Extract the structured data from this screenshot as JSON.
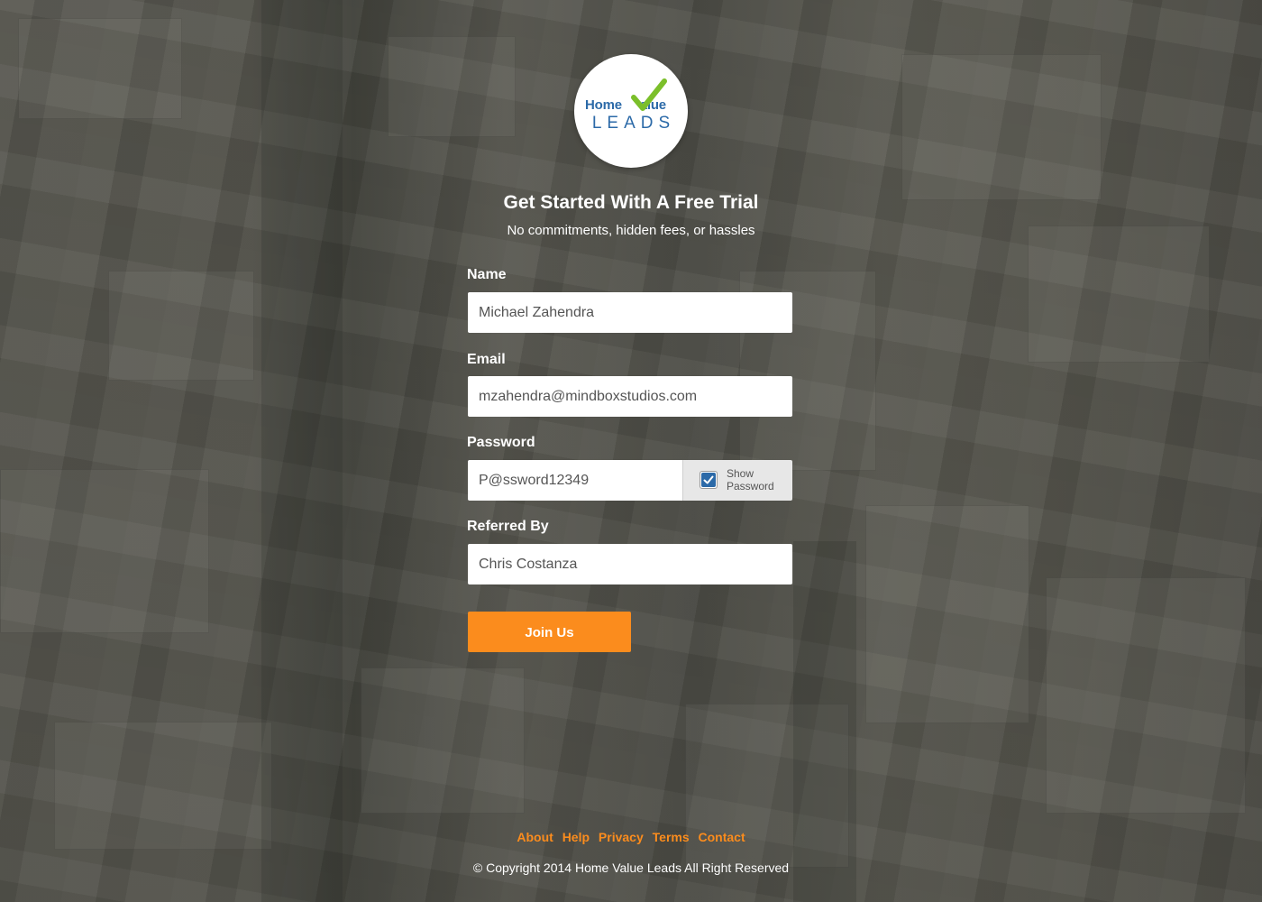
{
  "logo": {
    "brand_word_1": "Home",
    "brand_word_2": "alue",
    "brand_line_2": "LEADS",
    "check_icon": "checkmark-icon",
    "colors": {
      "blue": "#2c6aa8",
      "green": "#7bbf2a"
    }
  },
  "header": {
    "title": "Get Started With A Free Trial",
    "subtitle": "No commitments, hidden fees, or hassles"
  },
  "form": {
    "name_label": "Name",
    "name_value": "Michael Zahendra",
    "email_label": "Email",
    "email_value": "mzahendra@mindboxstudios.com",
    "password_label": "Password",
    "password_value": "P@ssword12349",
    "show_password_label": "Show Password",
    "show_password_checked": true,
    "referred_label": "Referred By",
    "referred_value": "Chris Costanza",
    "submit_label": "Join Us"
  },
  "footer": {
    "links": [
      "About",
      "Help",
      "Privacy",
      "Terms",
      "Contact"
    ],
    "copyright": "© Copyright 2014 Home Value Leads All Right Reserved"
  },
  "colors": {
    "accent": "#fb8c1d",
    "checkbox": "#2c6aa8"
  }
}
